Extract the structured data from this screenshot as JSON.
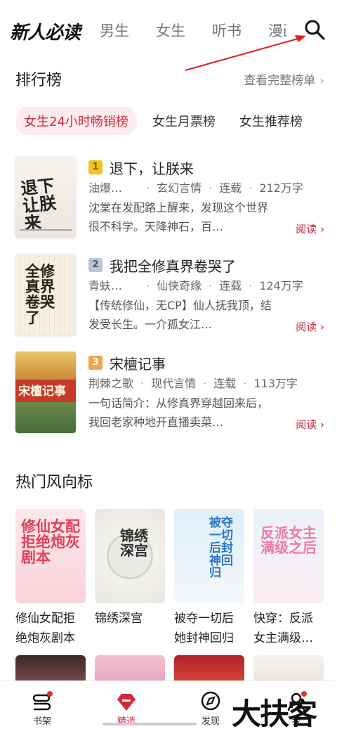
{
  "header": {
    "logo_text": "新人必读",
    "tabs": [
      "男生",
      "女生",
      "听书",
      "漫画"
    ],
    "colors": {
      "accent": "#d22a3a",
      "arrow": "#e02020"
    }
  },
  "ranking": {
    "title": "排行榜",
    "more": "查看完整榜单",
    "chips": [
      "女生24小时畅销榜",
      "女生月票榜",
      "女生推荐榜"
    ],
    "items": [
      {
        "rank": "1",
        "title": "退下，让朕来",
        "author": "油爆…",
        "genre": "玄幻言情",
        "status": "连载",
        "words": "212万字",
        "desc": "沈棠在发配路上醒来，发现这个世界很不科学。天降神石，百…",
        "read": "阅读",
        "cover_text": "退下让朕来"
      },
      {
        "rank": "2",
        "title": "我把全修真界卷哭了",
        "author": "青蚨…",
        "genre": "仙侠奇缘",
        "status": "连载",
        "words": "124万字",
        "desc": "【传统修仙，无CP】仙人抚我顶，结发受长生。一介孤女江…",
        "read": "阅读",
        "cover_text": "全修真界卷哭了"
      },
      {
        "rank": "3",
        "title": "宋檀记事",
        "author": "荆棘之歌",
        "genre": "现代言情",
        "status": "连载",
        "words": "113万字",
        "desc": "一句话简介：从修真界穿越回来后，我回老家种地开直播卖菜…",
        "read": "阅读",
        "cover_text": "宋檀记事"
      }
    ]
  },
  "hot": {
    "title": "热门风向标",
    "books": [
      {
        "name": "修仙女配拒绝炮灰剧本",
        "cover_text": "修仙女配拒绝炮灰剧本"
      },
      {
        "name": "锦绣深宫",
        "cover_text": "锦绣深宫"
      },
      {
        "name": "被夺一切后她封神回归",
        "cover_text": "被夺一切后封神回归"
      },
      {
        "name": "快穿：反派女主满级…",
        "cover_text": "反派女主满级之后"
      }
    ]
  },
  "bottom_nav": [
    {
      "label": "书架",
      "icon": "bookshelf-icon"
    },
    {
      "label": "精选",
      "icon": "featured-icon"
    },
    {
      "label": "发现",
      "icon": "compass-icon"
    },
    {
      "label": "我",
      "icon": "profile-icon"
    }
  ],
  "watermark": "大扶客"
}
